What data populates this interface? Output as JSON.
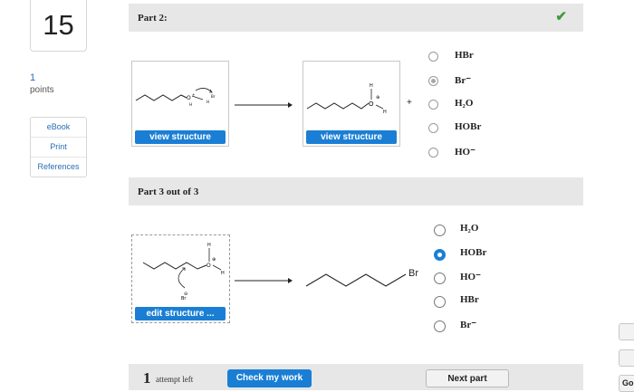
{
  "question": {
    "number": "15",
    "points_value": "1",
    "points_label": "points"
  },
  "sidebar": {
    "items": [
      {
        "label": "eBook"
      },
      {
        "label": "Print"
      },
      {
        "label": "References"
      }
    ]
  },
  "part2": {
    "title": "Part 2:",
    "status_icon": "checkmark-icon",
    "view_structure_left": "view structure",
    "view_structure_right": "view structure",
    "plus": "+",
    "options": [
      {
        "label": "HBr",
        "selected": false
      },
      {
        "label": "Br⁻",
        "selected": true
      },
      {
        "label": "H₂O",
        "selected": false
      },
      {
        "label": "HOBr",
        "selected": false
      },
      {
        "label": "HO⁻",
        "selected": false
      }
    ]
  },
  "part3": {
    "title": "Part 3 out of 3",
    "edit_structure": "edit structure ...",
    "product_label": "Br",
    "options": [
      {
        "label": "H₂O",
        "selected": false
      },
      {
        "label": "HOBr",
        "selected": true
      },
      {
        "label": "HO⁻",
        "selected": false
      },
      {
        "label": "HBr",
        "selected": false
      },
      {
        "label": "Br⁻",
        "selected": false
      }
    ]
  },
  "footer": {
    "attempts_count": "1",
    "attempts_label": "attempt left",
    "check_button": "Check my work",
    "next_button": "Next part"
  },
  "right_edge": {
    "partial_button_text": "Go"
  },
  "colors": {
    "accent": "#1a7fd4",
    "check": "#3d9b35",
    "bar": "#e7e7e7"
  }
}
